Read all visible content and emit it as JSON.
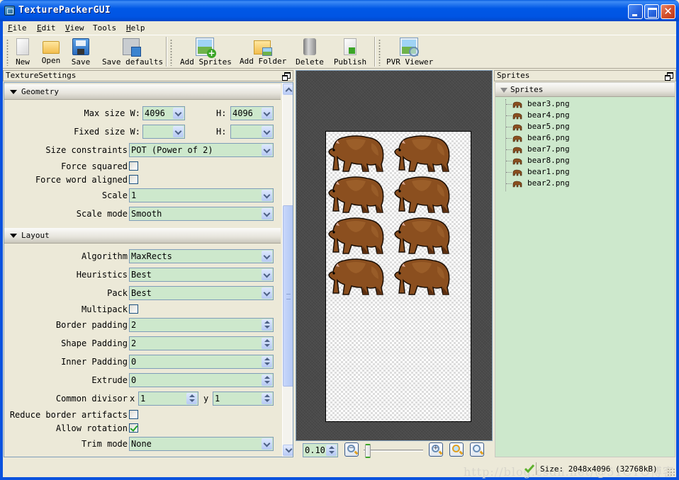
{
  "window": {
    "title": "TexturePackerGUI",
    "controls": [
      "minimize",
      "maximize",
      "close"
    ]
  },
  "menu": [
    {
      "label": "File",
      "mnemonic": "F",
      "rest": "ile"
    },
    {
      "label": "Edit",
      "mnemonic": "E",
      "rest": "dit"
    },
    {
      "label": "View",
      "mnemonic": "V",
      "rest": "iew"
    },
    {
      "label": "Tools",
      "mnemonic": "",
      "rest": "Tools"
    },
    {
      "label": "Help",
      "mnemonic": "H",
      "rest": "elp"
    }
  ],
  "toolbar": {
    "new": {
      "label": "New",
      "icon": "new-document-icon"
    },
    "open": {
      "label": "Open",
      "icon": "folder-open-icon"
    },
    "save": {
      "label": "Save",
      "icon": "floppy-disk-icon"
    },
    "save_defaults": {
      "label": "Save defaults",
      "icon": "save-defaults-icon"
    },
    "add_sprites": {
      "label": "Add Sprites",
      "icon": "add-image-icon"
    },
    "add_folder": {
      "label": "Add Folder",
      "icon": "add-folder-icon"
    },
    "delete": {
      "label": "Delete",
      "icon": "trash-can-icon"
    },
    "publish": {
      "label": "Publish",
      "icon": "publish-icon"
    },
    "pvr_viewer": {
      "label": "PVR Viewer",
      "icon": "image-magnifier-icon"
    }
  },
  "texture_settings": {
    "title": "TextureSettings",
    "geometry": {
      "header": "Geometry",
      "max_size_label": "Max size W:",
      "max_size_w": "4096",
      "max_size_h_label": "H:",
      "max_size_h": "4096",
      "fixed_size_label": "Fixed size W:",
      "fixed_size_w": "",
      "fixed_size_h_label": "H:",
      "fixed_size_h": "",
      "size_constraints_label": "Size constraints",
      "size_constraints": "POT (Power of 2)",
      "force_squared_label": "Force squared",
      "force_squared": false,
      "force_word_aligned_label": "Force word aligned",
      "force_word_aligned": false,
      "scale_label": "Scale",
      "scale": "1",
      "scale_mode_label": "Scale mode",
      "scale_mode": "Smooth"
    },
    "layout": {
      "header": "Layout",
      "algorithm_label": "Algorithm",
      "algorithm": "MaxRects",
      "heuristics_label": "Heuristics",
      "heuristics": "Best",
      "pack_label": "Pack",
      "pack": "Best",
      "multipack_label": "Multipack",
      "multipack": false,
      "border_padding_label": "Border padding",
      "border_padding": "2",
      "shape_padding_label": "Shape Padding",
      "shape_padding": "2",
      "inner_padding_label": "Inner Padding",
      "inner_padding": "0",
      "extrude_label": "Extrude",
      "extrude": "0",
      "common_divisor_label": "Common divisor",
      "common_divisor_x_label": "x",
      "common_divisor_x": "1",
      "common_divisor_y_label": "y",
      "common_divisor_y": "1",
      "reduce_border_artifacts_label": "Reduce border artifacts",
      "reduce_border_artifacts": false,
      "allow_rotation_label": "Allow rotation",
      "allow_rotation": true,
      "trim_mode_label": "Trim mode",
      "trim_mode": "None"
    }
  },
  "preview": {
    "sprite_count": 8,
    "zoom_value": "0.10",
    "zoom_slider_fraction": 0.02
  },
  "sprites_panel": {
    "title": "Sprites",
    "root": "Sprites",
    "items": [
      "bear3.png",
      "bear4.png",
      "bear5.png",
      "bear6.png",
      "bear7.png",
      "bear8.png",
      "bear1.png",
      "bear2.png"
    ]
  },
  "status": {
    "text": "Size: 2048x4096 (32768kB)",
    "watermark": "http://blog.csdn.net/@51CTO博客"
  },
  "colors": {
    "titlebar": "#0054e3",
    "field_bg": "#cde8cc",
    "panel_bg": "#ece9d8",
    "canvas_bg": "#4a4a4a",
    "bear": "#8b4f1f"
  }
}
